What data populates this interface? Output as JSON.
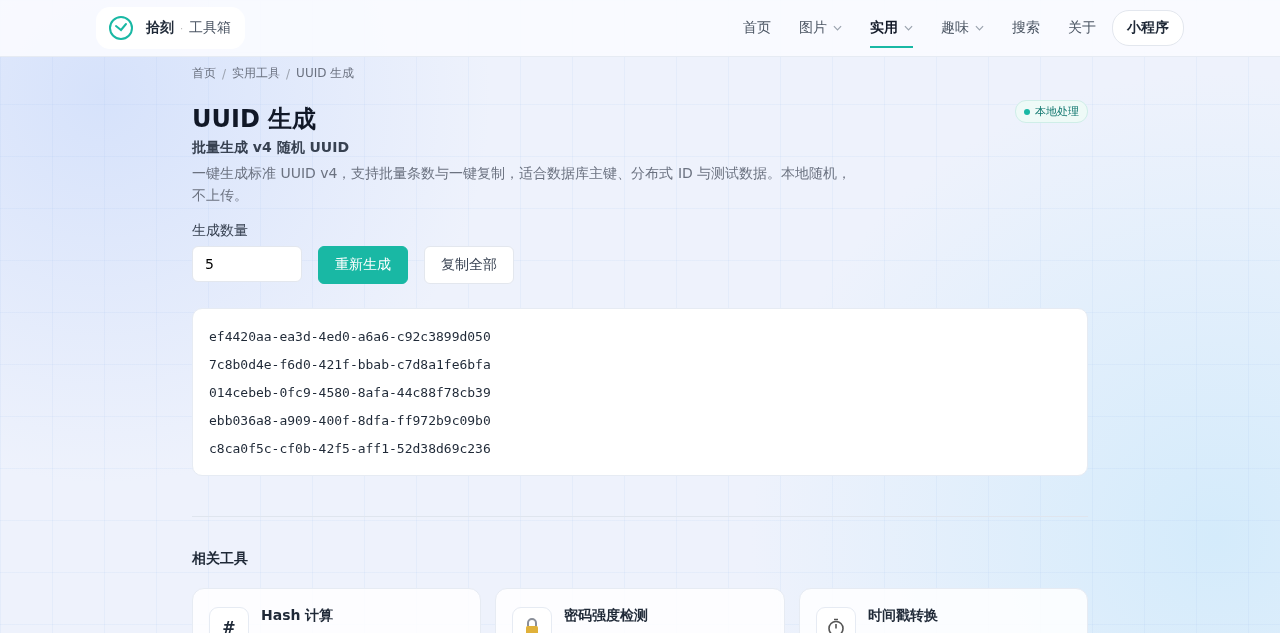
{
  "header": {
    "logo": {
      "name": "拾刻",
      "sep": "·",
      "sub": "工具箱"
    },
    "nav": [
      {
        "label": "首页",
        "selected": false,
        "dropdown": false
      },
      {
        "label": "图片",
        "selected": false,
        "dropdown": true
      },
      {
        "label": "实用",
        "selected": true,
        "dropdown": true
      },
      {
        "label": "趣味",
        "selected": false,
        "dropdown": true
      },
      {
        "label": "搜索",
        "selected": false,
        "dropdown": false
      },
      {
        "label": "关于",
        "selected": false,
        "dropdown": false
      }
    ],
    "cta": "小程序"
  },
  "breadcrumb": {
    "separator": "/",
    "items": [
      "首页",
      "实用工具",
      "UUID 生成"
    ]
  },
  "title": "UUID 生成",
  "badge": "本地处理",
  "subtitle": "批量生成 v4 随机 UUID",
  "description": "一键生成标准 UUID v4，支持批量条数与一键复制，适合数据库主键、分布式 ID 与测试数据。本地随机，不上传。",
  "form": {
    "label": "生成数量",
    "value": "5",
    "primary": "重新生成",
    "secondary": "复制全部"
  },
  "results": [
    "ef4420aa-ea3d-4ed0-a6a6-c92c3899d050",
    "7c8b0d4e-f6d0-421f-bbab-c7d8a1fe6bfa",
    "014cebeb-0fc9-4580-8afa-44c88f78cb39",
    "ebb036a8-a909-400f-8dfa-ff972b9c09b0",
    "c8ca0f5c-cf0b-42f5-aff1-52d38d69c236"
  ],
  "related": {
    "heading": "相关工具",
    "cards": [
      {
        "kind": "glyph",
        "glyph": "#",
        "title": "Hash 计算"
      },
      {
        "kind": "lock",
        "title": "密码强度检测"
      },
      {
        "kind": "stopwatch",
        "title": "时间戳转换"
      }
    ]
  }
}
